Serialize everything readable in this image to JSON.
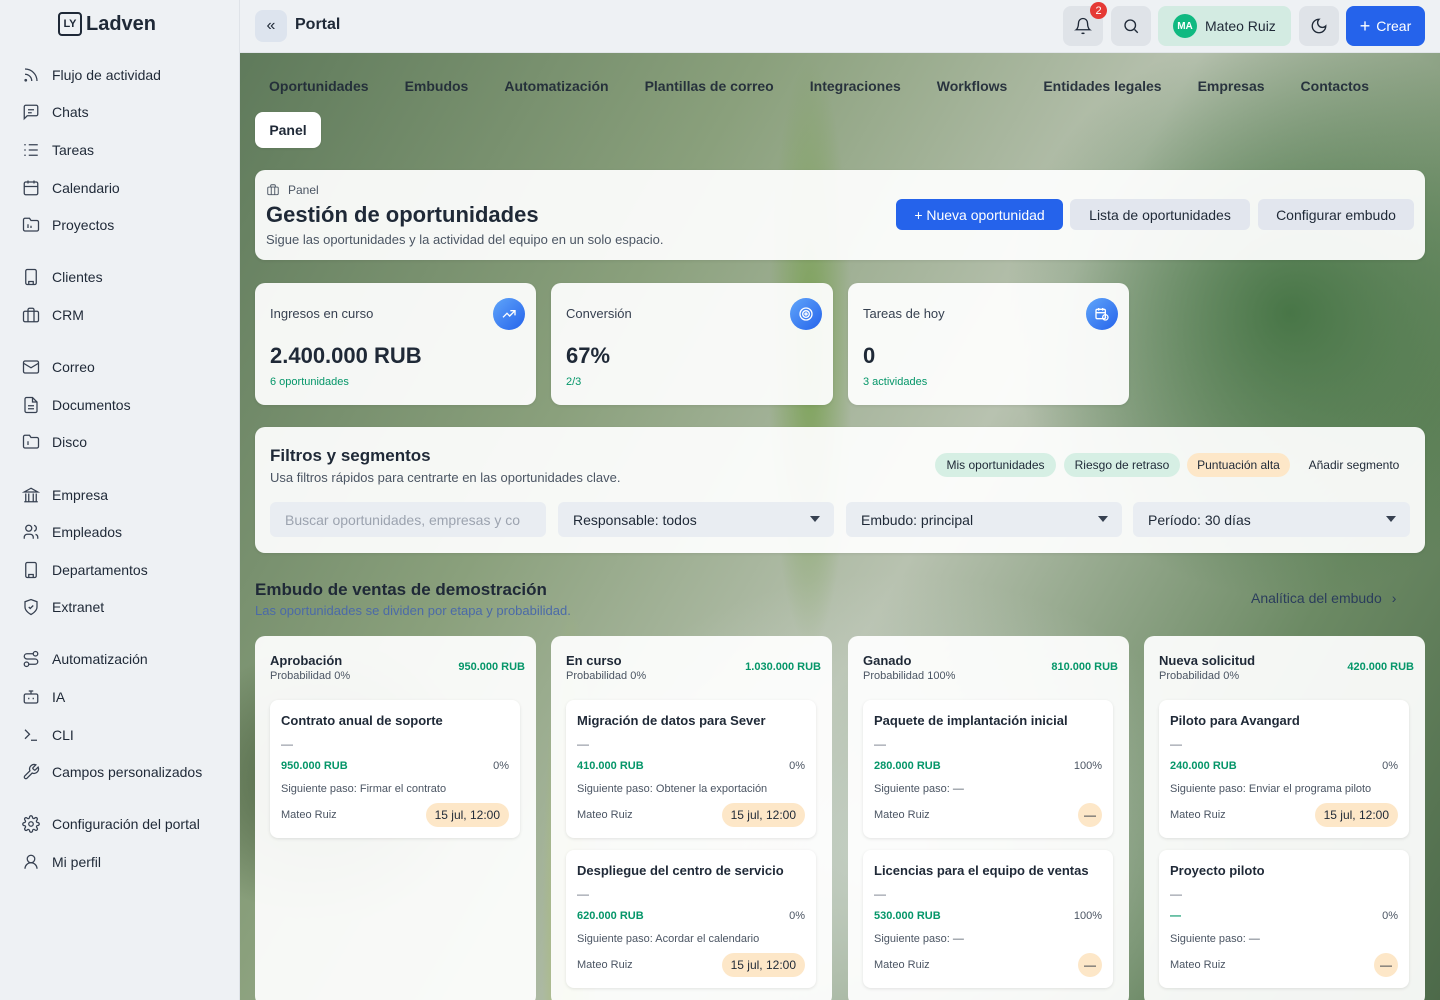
{
  "app": {
    "name": "Ladven",
    "logo_mark": "LY"
  },
  "sidebar": {
    "groups": [
      [
        {
          "label": "Flujo de actividad",
          "icon": "rss-icon"
        },
        {
          "label": "Chats",
          "icon": "chat-icon"
        },
        {
          "label": "Tareas",
          "icon": "tasks-icon"
        },
        {
          "label": "Calendario",
          "icon": "calendar-icon"
        },
        {
          "label": "Proyectos",
          "icon": "folder-icon"
        }
      ],
      [
        {
          "label": "Clientes",
          "icon": "building-icon"
        },
        {
          "label": "CRM",
          "icon": "briefcase-icon"
        }
      ],
      [
        {
          "label": "Correo",
          "icon": "mail-icon"
        },
        {
          "label": "Documentos",
          "icon": "document-icon"
        },
        {
          "label": "Disco",
          "icon": "disk-icon"
        }
      ],
      [
        {
          "label": "Empresa",
          "icon": "bank-icon"
        },
        {
          "label": "Empleados",
          "icon": "users-icon"
        },
        {
          "label": "Departamentos",
          "icon": "building-icon"
        },
        {
          "label": "Extranet",
          "icon": "shield-icon"
        }
      ],
      [
        {
          "label": "Automatización",
          "icon": "workflow-icon"
        },
        {
          "label": "IA",
          "icon": "bot-icon"
        },
        {
          "label": "CLI",
          "icon": "terminal-icon"
        },
        {
          "label": "Campos personalizados",
          "icon": "wrench-icon"
        }
      ],
      [
        {
          "label": "Configuración del portal",
          "icon": "gear-icon"
        },
        {
          "label": "Mi perfil",
          "icon": "user-icon"
        }
      ]
    ]
  },
  "header": {
    "title": "Portal",
    "notifications_count": "2",
    "user": {
      "initials": "MA",
      "name": "Mateo Ruiz"
    },
    "create_label": "Crear"
  },
  "tabs": [
    "Oportunidades",
    "Embudos",
    "Automatización",
    "Plantillas de correo",
    "Integraciones",
    "Workflows",
    "Entidades legales",
    "Empresas",
    "Contactos"
  ],
  "subtab": "Panel",
  "page": {
    "breadcrumb": "Panel",
    "title": "Gestión de oportunidades",
    "subtitle": "Sigue las oportunidades y la actividad del equipo en un solo espacio.",
    "actions": {
      "new": "+ Nueva oportunidad",
      "list": "Lista de oportunidades",
      "configure": "Configurar embudo"
    }
  },
  "stats": [
    {
      "label": "Ingresos en curso",
      "value": "2.400.000 RUB",
      "sub": "6 oportunidades",
      "icon": "trending-up-icon"
    },
    {
      "label": "Conversión",
      "value": "67%",
      "sub": "2/3",
      "icon": "target-icon"
    },
    {
      "label": "Tareas de hoy",
      "value": "0",
      "sub": "3 actividades",
      "icon": "calendar-clock-icon"
    }
  ],
  "filters": {
    "title": "Filtros y segmentos",
    "subtitle": "Usa filtros rápidos para centrarte en las oportunidades clave.",
    "segments": [
      "Mis oportunidades",
      "Riesgo de retraso",
      "Puntuación alta",
      "Añadir segmento"
    ],
    "search_placeholder": "Buscar oportunidades, empresas y co",
    "owner": "Responsable: todos",
    "pipeline": "Embudo: principal",
    "period": "Período: 30 días"
  },
  "pipeline": {
    "title": "Embudo de ventas de demostración",
    "subtitle": "Las oportunidades se dividen por etapa y probabilidad.",
    "link": "Analítica del embudo",
    "columns": [
      {
        "name": "Aprobación",
        "prob": "Probabilidad 0%",
        "amount": "950.000 RUB",
        "deals": [
          {
            "name": "Contrato anual de soporte",
            "dash": "—",
            "amount": "950.000 RUB",
            "pct": "0%",
            "next": "Siguiente paso: Firmar el contrato",
            "owner": "Mateo Ruiz",
            "date": "15 jul, 12:00"
          }
        ]
      },
      {
        "name": "En curso",
        "prob": "Probabilidad 0%",
        "amount": "1.030.000 RUB",
        "deals": [
          {
            "name": "Migración de datos para Sever",
            "dash": "—",
            "amount": "410.000 RUB",
            "pct": "0%",
            "next": "Siguiente paso: Obtener la exportación",
            "owner": "Mateo Ruiz",
            "date": "15 jul, 12:00"
          },
          {
            "name": "Despliegue del centro de servicio",
            "dash": "—",
            "amount": "620.000 RUB",
            "pct": "0%",
            "next": "Siguiente paso: Acordar el calendario",
            "owner": "Mateo Ruiz",
            "date": "15 jul, 12:00"
          }
        ]
      },
      {
        "name": "Ganado",
        "prob": "Probabilidad 100%",
        "amount": "810.000 RUB",
        "deals": [
          {
            "name": "Paquete de implantación inicial",
            "dash": "—",
            "amount": "280.000 RUB",
            "pct": "100%",
            "next": "Siguiente paso: —",
            "owner": "Mateo Ruiz",
            "date": "—"
          },
          {
            "name": "Licencias para el equipo de ventas",
            "dash": "—",
            "amount": "530.000 RUB",
            "pct": "100%",
            "next": "Siguiente paso: —",
            "owner": "Mateo Ruiz",
            "date": "—"
          }
        ]
      },
      {
        "name": "Nueva solicitud",
        "prob": "Probabilidad 0%",
        "amount": "420.000 RUB",
        "deals": [
          {
            "name": "Piloto para Avangard",
            "dash": "—",
            "amount": "240.000 RUB",
            "pct": "0%",
            "next": "Siguiente paso: Enviar el programa piloto",
            "owner": "Mateo Ruiz",
            "date": "15 jul, 12:00"
          },
          {
            "name": "Proyecto piloto",
            "dash": "—",
            "amount": "—",
            "pct": "0%",
            "next": "Siguiente paso: —",
            "owner": "Mateo Ruiz",
            "date": "—"
          }
        ]
      }
    ]
  }
}
